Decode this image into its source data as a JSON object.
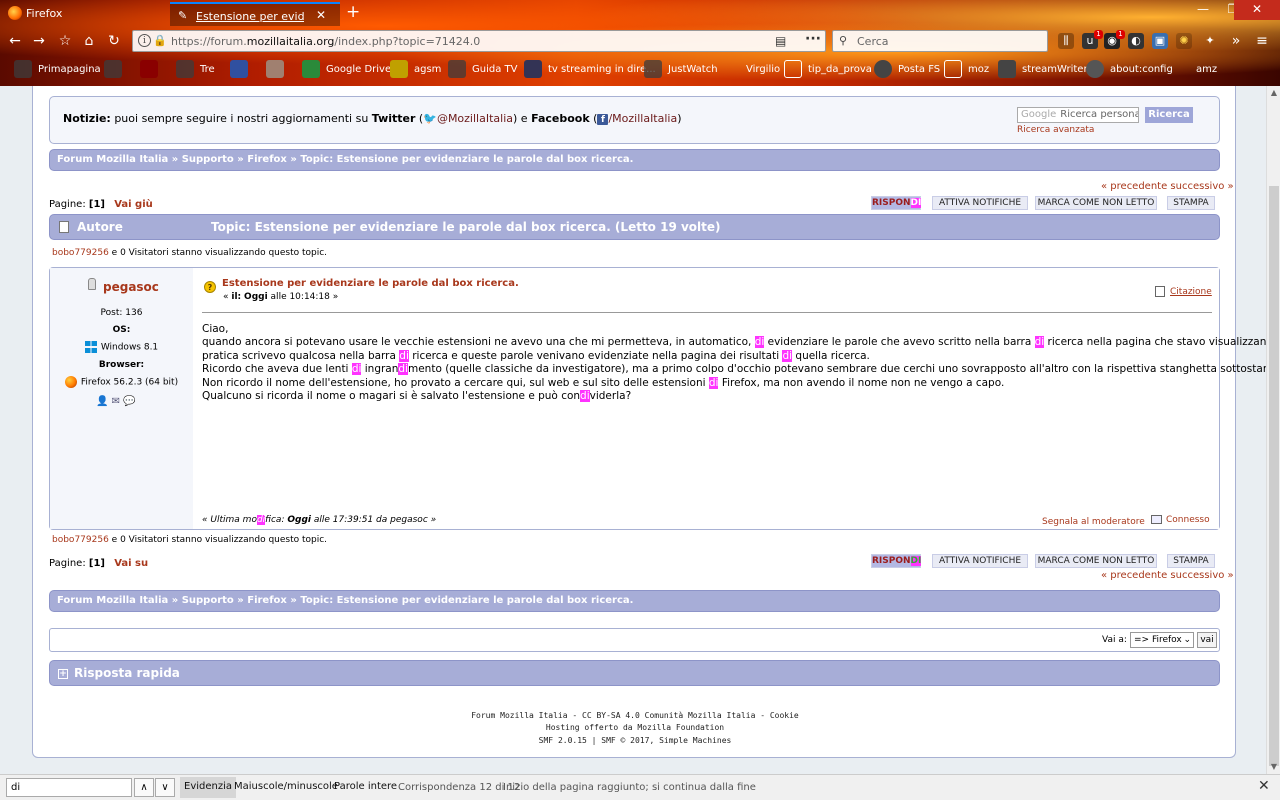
{
  "browser": {
    "app_title": "Firefox",
    "tab_label": "Estensione per evidenziare le parole",
    "url_prefix": "https://forum.",
    "url_domain": "mozillaitalia.org",
    "url_path": "/index.php?topic=71424.0",
    "search_placeholder": "Cerca",
    "toolbar_badges": [
      "1",
      "1"
    ],
    "bookmarks": [
      "Primapagina",
      "Tre",
      "Google Drive",
      "agsm",
      "Guida TV",
      "tv streaming in dire...",
      "JustWatch",
      "Virgilio",
      "tip_da_prova",
      "Posta FS",
      "moz",
      "streamWriter",
      "about:config",
      "amz"
    ]
  },
  "news": {
    "label": "Notizie:",
    "text": "puoi sempre seguire i nostri aggiornamenti su",
    "twitter_label": "Twitter",
    "twitter_handle": "@MozillaItalia",
    "and": "e",
    "facebook_label": "Facebook",
    "facebook_handle": "/MozillaItalia",
    "search_brand": "Google",
    "search_placeholder": "Ricerca personalizzata",
    "search_button": "Ricerca",
    "advanced_search": "Ricerca avanzata"
  },
  "linktree": {
    "items": [
      "Forum Mozilla Italia",
      "Supporto",
      "Firefox",
      "Topic: Estensione per evidenziare le parole dal box ricerca."
    ],
    "separator": "»"
  },
  "prevnext": "« precedente successivo »",
  "pagination": {
    "label": "Pagine:",
    "current": "[1]",
    "go_down": "Vai giù",
    "go_up": "Vai su"
  },
  "buttons": {
    "reply_a": "RISPON",
    "reply_b": "DI",
    "notify": "ATTIVA NOTIFICHE",
    "mark_unread": "MARCA COME NON LETTO",
    "print": "STAMPA"
  },
  "topic_header": {
    "author_label": "Autore",
    "title": "Topic: Estensione per evidenziare le parole dal box ricerca.  (Letto 19 volte)"
  },
  "viewers": {
    "user": "bobo779256",
    "text": "e 0 Visitatori stanno visualizzando questo topic."
  },
  "post": {
    "poster": "pegasoc",
    "posts": "Post: 136",
    "os_label": "OS:",
    "os_value": "Windows 8.1",
    "browser_label": "Browser:",
    "browser_value": "Firefox 56.2.3 (64 bit)",
    "subject": "Estensione per evidenziare le parole dal box ricerca.",
    "on_prefix": "«",
    "on_label": "il:",
    "on_day": "Oggi",
    "on_time": "alle 10:14:18 »",
    "quote_label": "Citazione",
    "last_edit_a": "« Ultima mo",
    "last_edit_b": "di",
    "last_edit_c": "fica:",
    "last_edit_day": "Oggi",
    "last_edit_rest": "alle 17:39:51 da pegasoc »",
    "report": "Segnala al moderatore",
    "logged": "Connesso"
  },
  "jump": {
    "label": "Vai a:",
    "selected": "=> Firefox",
    "go": "vai"
  },
  "quick_reply": "Risposta rapida",
  "footer": [
    "Forum Mozilla Italia - CC BY-SA 4.0 Comunità Mozilla Italia - Cookie",
    "Hosting offerto da Mozilla Foundation",
    "SMF 2.0.15 | SMF © 2017, Simple Machines"
  ],
  "findbar": {
    "query": "di",
    "highlight": "Evidenzia",
    "match_case": "Maiuscole/minuscole",
    "whole_words": "Parole intere",
    "matches": "Corrispondenza 12 di 12",
    "wrap_notice": "Inizio della pagina raggiunto; si continua dalla fine"
  }
}
